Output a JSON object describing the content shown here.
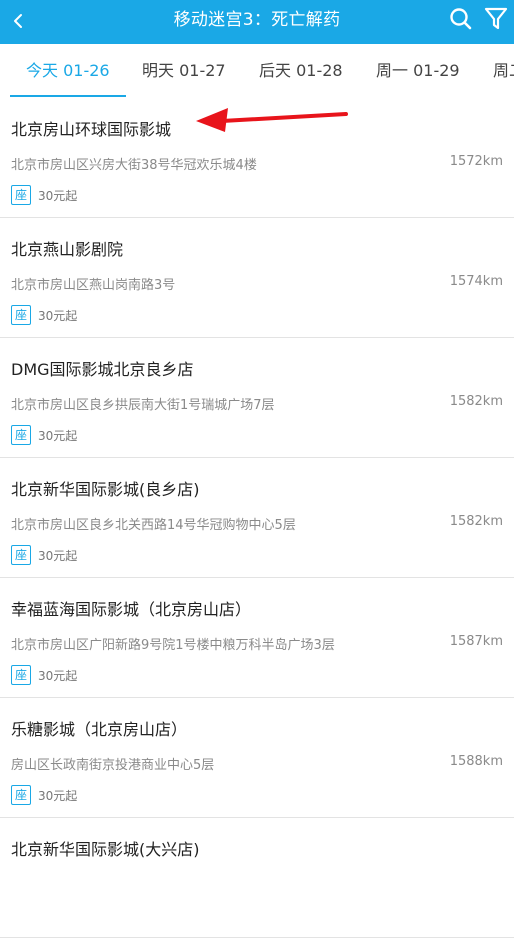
{
  "header": {
    "title": "移动迷宫3：死亡解药",
    "back_icon": "chevron-left-icon",
    "search_icon": "search-icon",
    "filter_icon": "filter-icon",
    "bg_color": "#1aa8e6"
  },
  "tabs": [
    {
      "label": "今天 01-26",
      "active": true
    },
    {
      "label": "明天 01-27",
      "active": false
    },
    {
      "label": "后天 01-28",
      "active": false
    },
    {
      "label": "周一 01-29",
      "active": false
    },
    {
      "label": "周二",
      "active": false
    }
  ],
  "cinemas": [
    {
      "name": "北京房山环球国际影城",
      "address": "北京市房山区兴房大街38号华冠欢乐城4楼",
      "distance": "1572km",
      "seat_badge": "座",
      "price": "30元起"
    },
    {
      "name": "北京燕山影剧院",
      "address": "北京市房山区燕山岗南路3号",
      "distance": "1574km",
      "seat_badge": "座",
      "price": "30元起"
    },
    {
      "name": "DMG国际影城北京良乡店",
      "address": "北京市房山区良乡拱辰南大街1号瑞城广场7层",
      "distance": "1582km",
      "seat_badge": "座",
      "price": "30元起"
    },
    {
      "name": "北京新华国际影城(良乡店)",
      "address": "北京市房山区良乡北关西路14号华冠购物中心5层",
      "distance": "1582km",
      "seat_badge": "座",
      "price": "30元起"
    },
    {
      "name": "幸福蓝海国际影城（北京房山店）",
      "address": "北京市房山区广阳新路9号院1号楼中粮万科半岛广场3层",
      "distance": "1587km",
      "seat_badge": "座",
      "price": "30元起"
    },
    {
      "name": "乐糖影城（北京房山店）",
      "address": "房山区长政南街京投港商业中心5层",
      "distance": "1588km",
      "seat_badge": "座",
      "price": "30元起"
    },
    {
      "name": "北京新华国际影城(大兴店)",
      "address": "",
      "distance": "",
      "seat_badge": "",
      "price": ""
    }
  ],
  "annotation": {
    "arrow_color": "#e8141b"
  }
}
